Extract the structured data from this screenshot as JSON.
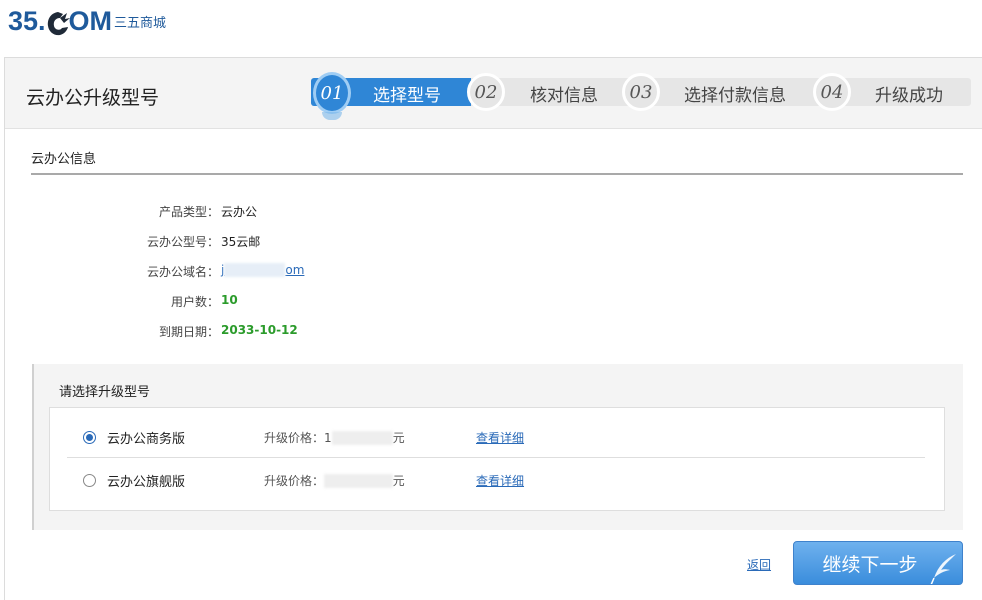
{
  "brand": {
    "logo_left": "35.",
    "logo_right": "OM",
    "logo_sub": "三五商城"
  },
  "page": {
    "title": "云办公升级型号"
  },
  "steps": [
    {
      "num": "01",
      "label": "选择型号",
      "active": true
    },
    {
      "num": "02",
      "label": "核对信息",
      "active": false
    },
    {
      "num": "03",
      "label": "选择付款信息",
      "active": false
    },
    {
      "num": "04",
      "label": "升级成功",
      "active": false
    }
  ],
  "info": {
    "section_title": "云办公信息",
    "rows": [
      {
        "label": "产品类型：",
        "value": "云办公"
      },
      {
        "label": "云办公型号：",
        "value": "35云邮"
      },
      {
        "label": "云办公域名：",
        "value_prefix": "j",
        "value_suffix": "om"
      },
      {
        "label": "用户数：",
        "value": "10"
      },
      {
        "label": "到期日期：",
        "value": "2033-10-12"
      }
    ]
  },
  "upgrade": {
    "title": "请选择升级型号",
    "options": [
      {
        "name": "云办公商务版",
        "price_label": "升级价格：",
        "price_visible_start": "1",
        "price_visible_end": "元",
        "detail": "查看详细",
        "selected": true
      },
      {
        "name": "云办公旗舰版",
        "price_label": "升级价格：",
        "price_visible_start": "",
        "price_visible_end": "元",
        "detail": "查看详细",
        "selected": false
      }
    ]
  },
  "actions": {
    "back": "返回",
    "next": "继续下一步"
  },
  "colors": {
    "brand_blue": "#1f5a9b",
    "active_step": "#2f86d6",
    "green_value": "#2b9b2b",
    "link": "#2a6ab8"
  }
}
